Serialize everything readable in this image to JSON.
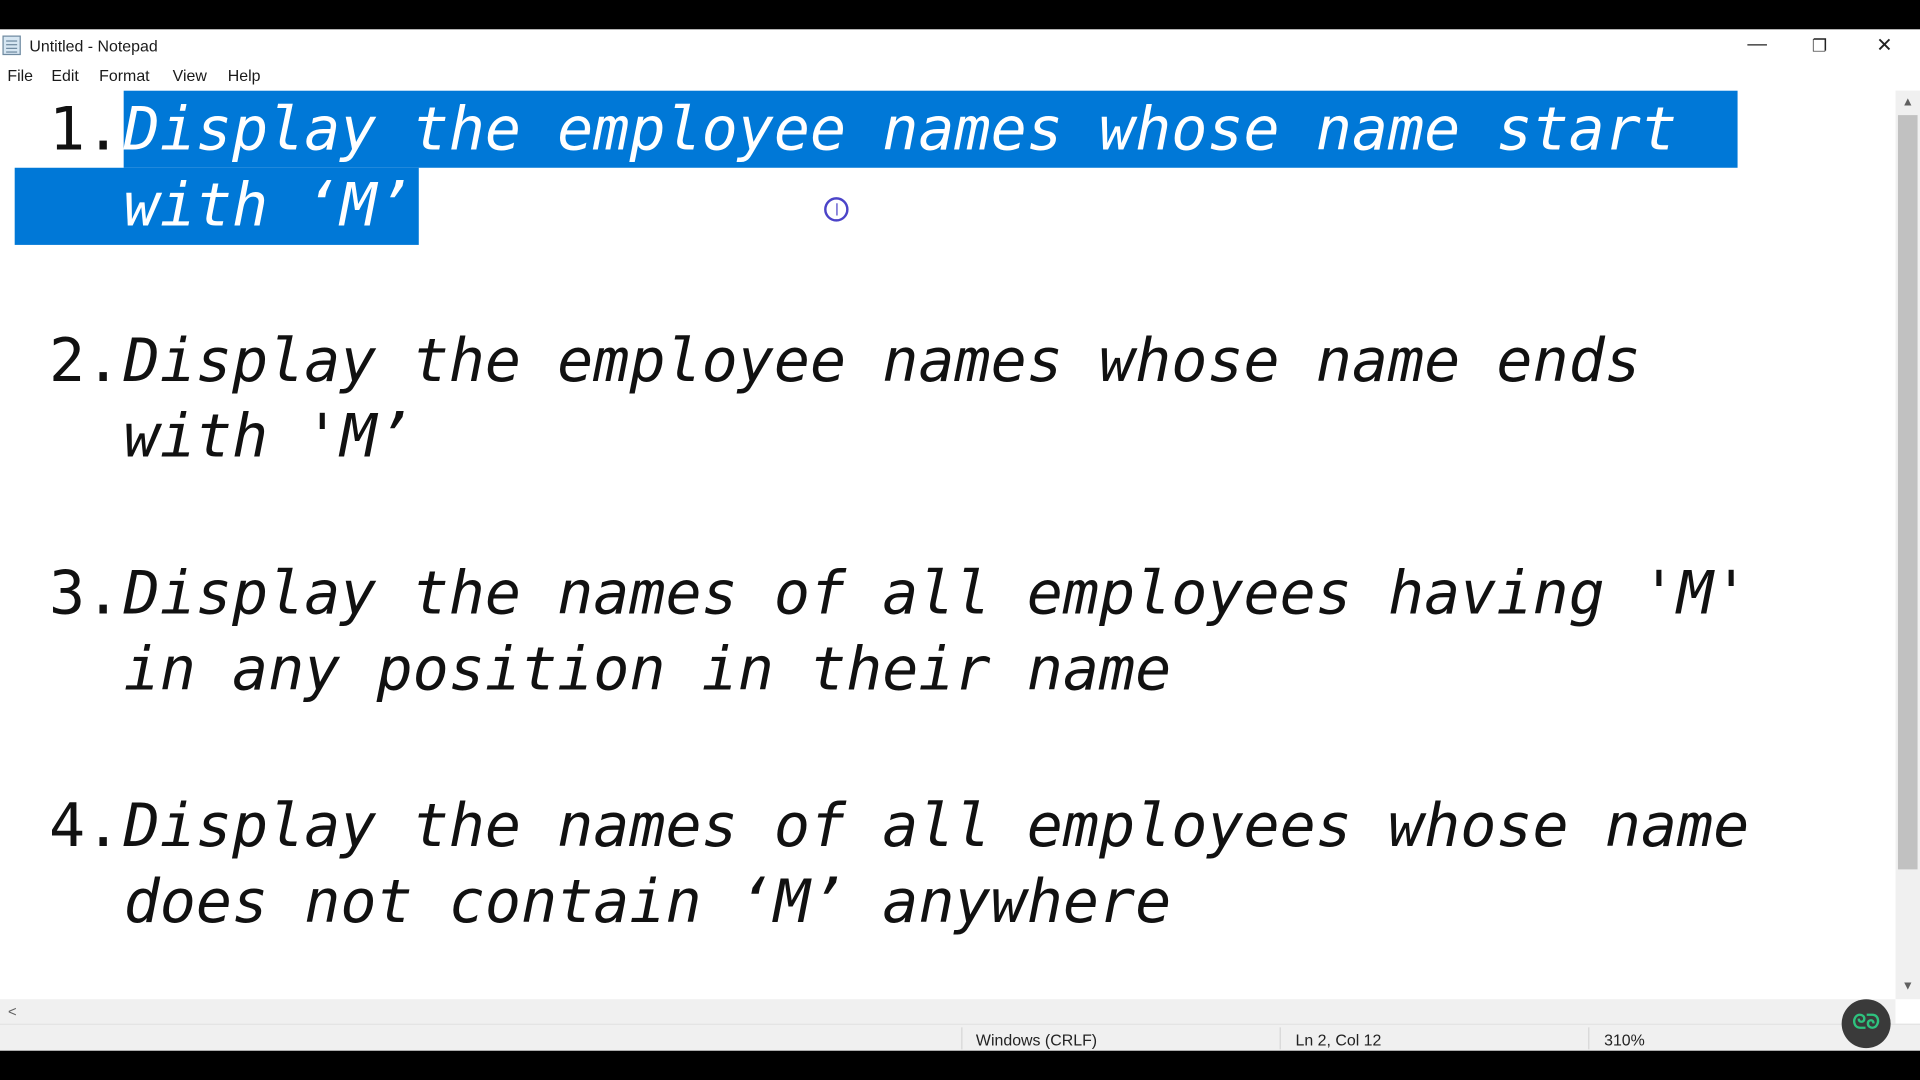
{
  "window": {
    "title": "Untitled - Notepad",
    "minimize_glyph": "—",
    "restore_glyph": "❐",
    "close_glyph": "✕"
  },
  "menu": {
    "items": [
      "File",
      "Edit",
      "Format",
      "View",
      "Help"
    ]
  },
  "editor": {
    "items": [
      {
        "number": "1.",
        "line1": "Display the employee names whose name start",
        "line2": "with ‘M’"
      },
      {
        "number": "2.",
        "line1": "Display the employee names whose name ends",
        "line2": "with 'M’"
      },
      {
        "number": "3.",
        "line1": "Display the names of all employees having 'M'",
        "line2": "in any position in their name"
      },
      {
        "number": "4.",
        "line1": "Display the names of all employees whose name",
        "line2": "does not contain ‘M’ anywhere"
      }
    ],
    "selection_color": "#0078d7"
  },
  "scrollbar": {
    "up_arrow": "▲",
    "down_arrow": "▼",
    "left_arrow": "<"
  },
  "status": {
    "line_ending": "Windows (CRLF)",
    "position": "Ln 2, Col 12",
    "zoom": "310%"
  },
  "badge": {
    "icon": "geeksforgeeks-logo-icon",
    "glyph": "ᘓᘐ"
  }
}
